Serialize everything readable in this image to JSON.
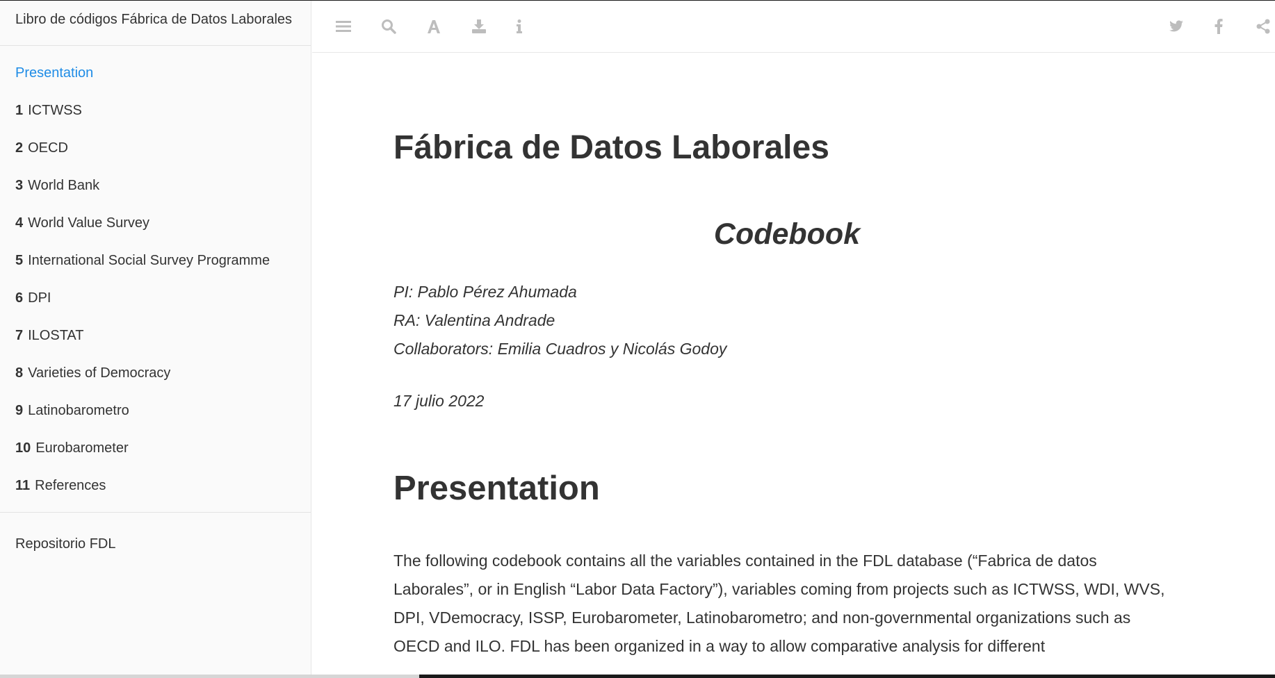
{
  "sidebar": {
    "title": "Libro de códigos Fábrica de Datos Laborales",
    "items": [
      {
        "num": "",
        "label": "Presentation",
        "active": true
      },
      {
        "num": "1",
        "label": "ICTWSS"
      },
      {
        "num": "2",
        "label": "OECD"
      },
      {
        "num": "3",
        "label": "World Bank"
      },
      {
        "num": "4",
        "label": "World Value Survey"
      },
      {
        "num": "5",
        "label": "International Social Survey Programme"
      },
      {
        "num": "6",
        "label": "DPI"
      },
      {
        "num": "7",
        "label": "ILOSTAT"
      },
      {
        "num": "8",
        "label": "Varieties of Democracy"
      },
      {
        "num": "9",
        "label": "Latinobarometro"
      },
      {
        "num": "10",
        "label": "Eurobarometer"
      },
      {
        "num": "11",
        "label": "References"
      }
    ],
    "repo_link": "Repositorio FDL"
  },
  "toolbar": {
    "icons": [
      "list-icon",
      "search-icon",
      "font-icon",
      "download-icon",
      "info-icon",
      "twitter-icon",
      "facebook-icon",
      "share-icon"
    ]
  },
  "content": {
    "title": "Fábrica de Datos Laborales",
    "subtitle": "Codebook",
    "pi": "PI: Pablo Pérez Ahumada",
    "ra": "RA: Valentina Andrade",
    "collaborators": "Collaborators: Emilia Cuadros y Nicolás Godoy",
    "date": "17 julio 2022",
    "section_title": "Presentation",
    "paragraph": "The following codebook contains all the variables contained in the FDL database (“Fabrica de datos Laborales”, or in English “Labor Data Factory”), variables coming from projects such as ICTWSS, WDI, WVS, DPI, VDemocracy, ISSP, Eurobarometer, Latinobarometro; and non-governmental organizations such as OECD and ILO. FDL has been organized in a way to allow comparative analysis for different"
  },
  "colors": {
    "accent": "#1f8ce6",
    "icon": "#bdbdbd",
    "text": "#333333"
  }
}
